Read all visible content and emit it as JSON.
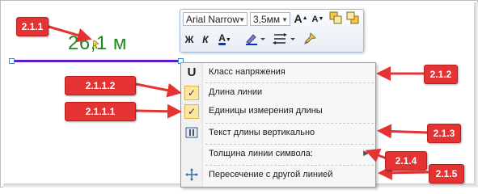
{
  "canvas": {
    "measurement_text": "26,1 м"
  },
  "toolbar": {
    "font_family": "Arial Narrow",
    "font_size": "3,5мм",
    "grow_font": "A",
    "shrink_font": "A",
    "bold": "Ж",
    "italic": "К",
    "font_color": "A"
  },
  "context_menu": {
    "items": [
      {
        "icon": "U",
        "label": "Класс напряжения"
      },
      {
        "icon": "✓",
        "label": "Длина линии"
      },
      {
        "icon": "✓",
        "label": "Единицы измерения длины"
      },
      {
        "icon": "vertical-text-icon",
        "label": "Текст длины вертикально"
      },
      {
        "icon": "",
        "label": "Толщина линии символа:"
      },
      {
        "icon": "cross-arrows-icon",
        "label": "Пересечение с другой линией"
      }
    ]
  },
  "callouts": {
    "c_2_1_1": "2.1.1",
    "c_2_1_1_2": "2.1.1.2",
    "c_2_1_1_1": "2.1.1.1",
    "c_2_1_2": "2.1.2",
    "c_2_1_3": "2.1.3",
    "c_2_1_4": "2.1.4",
    "c_2_1_5": "2.1.5"
  },
  "colors": {
    "callout_red": "#e53232",
    "line_purple": "#5b1bd0",
    "measure_green": "#1e8a1e",
    "checked_highlight": "#fbe7a2"
  }
}
